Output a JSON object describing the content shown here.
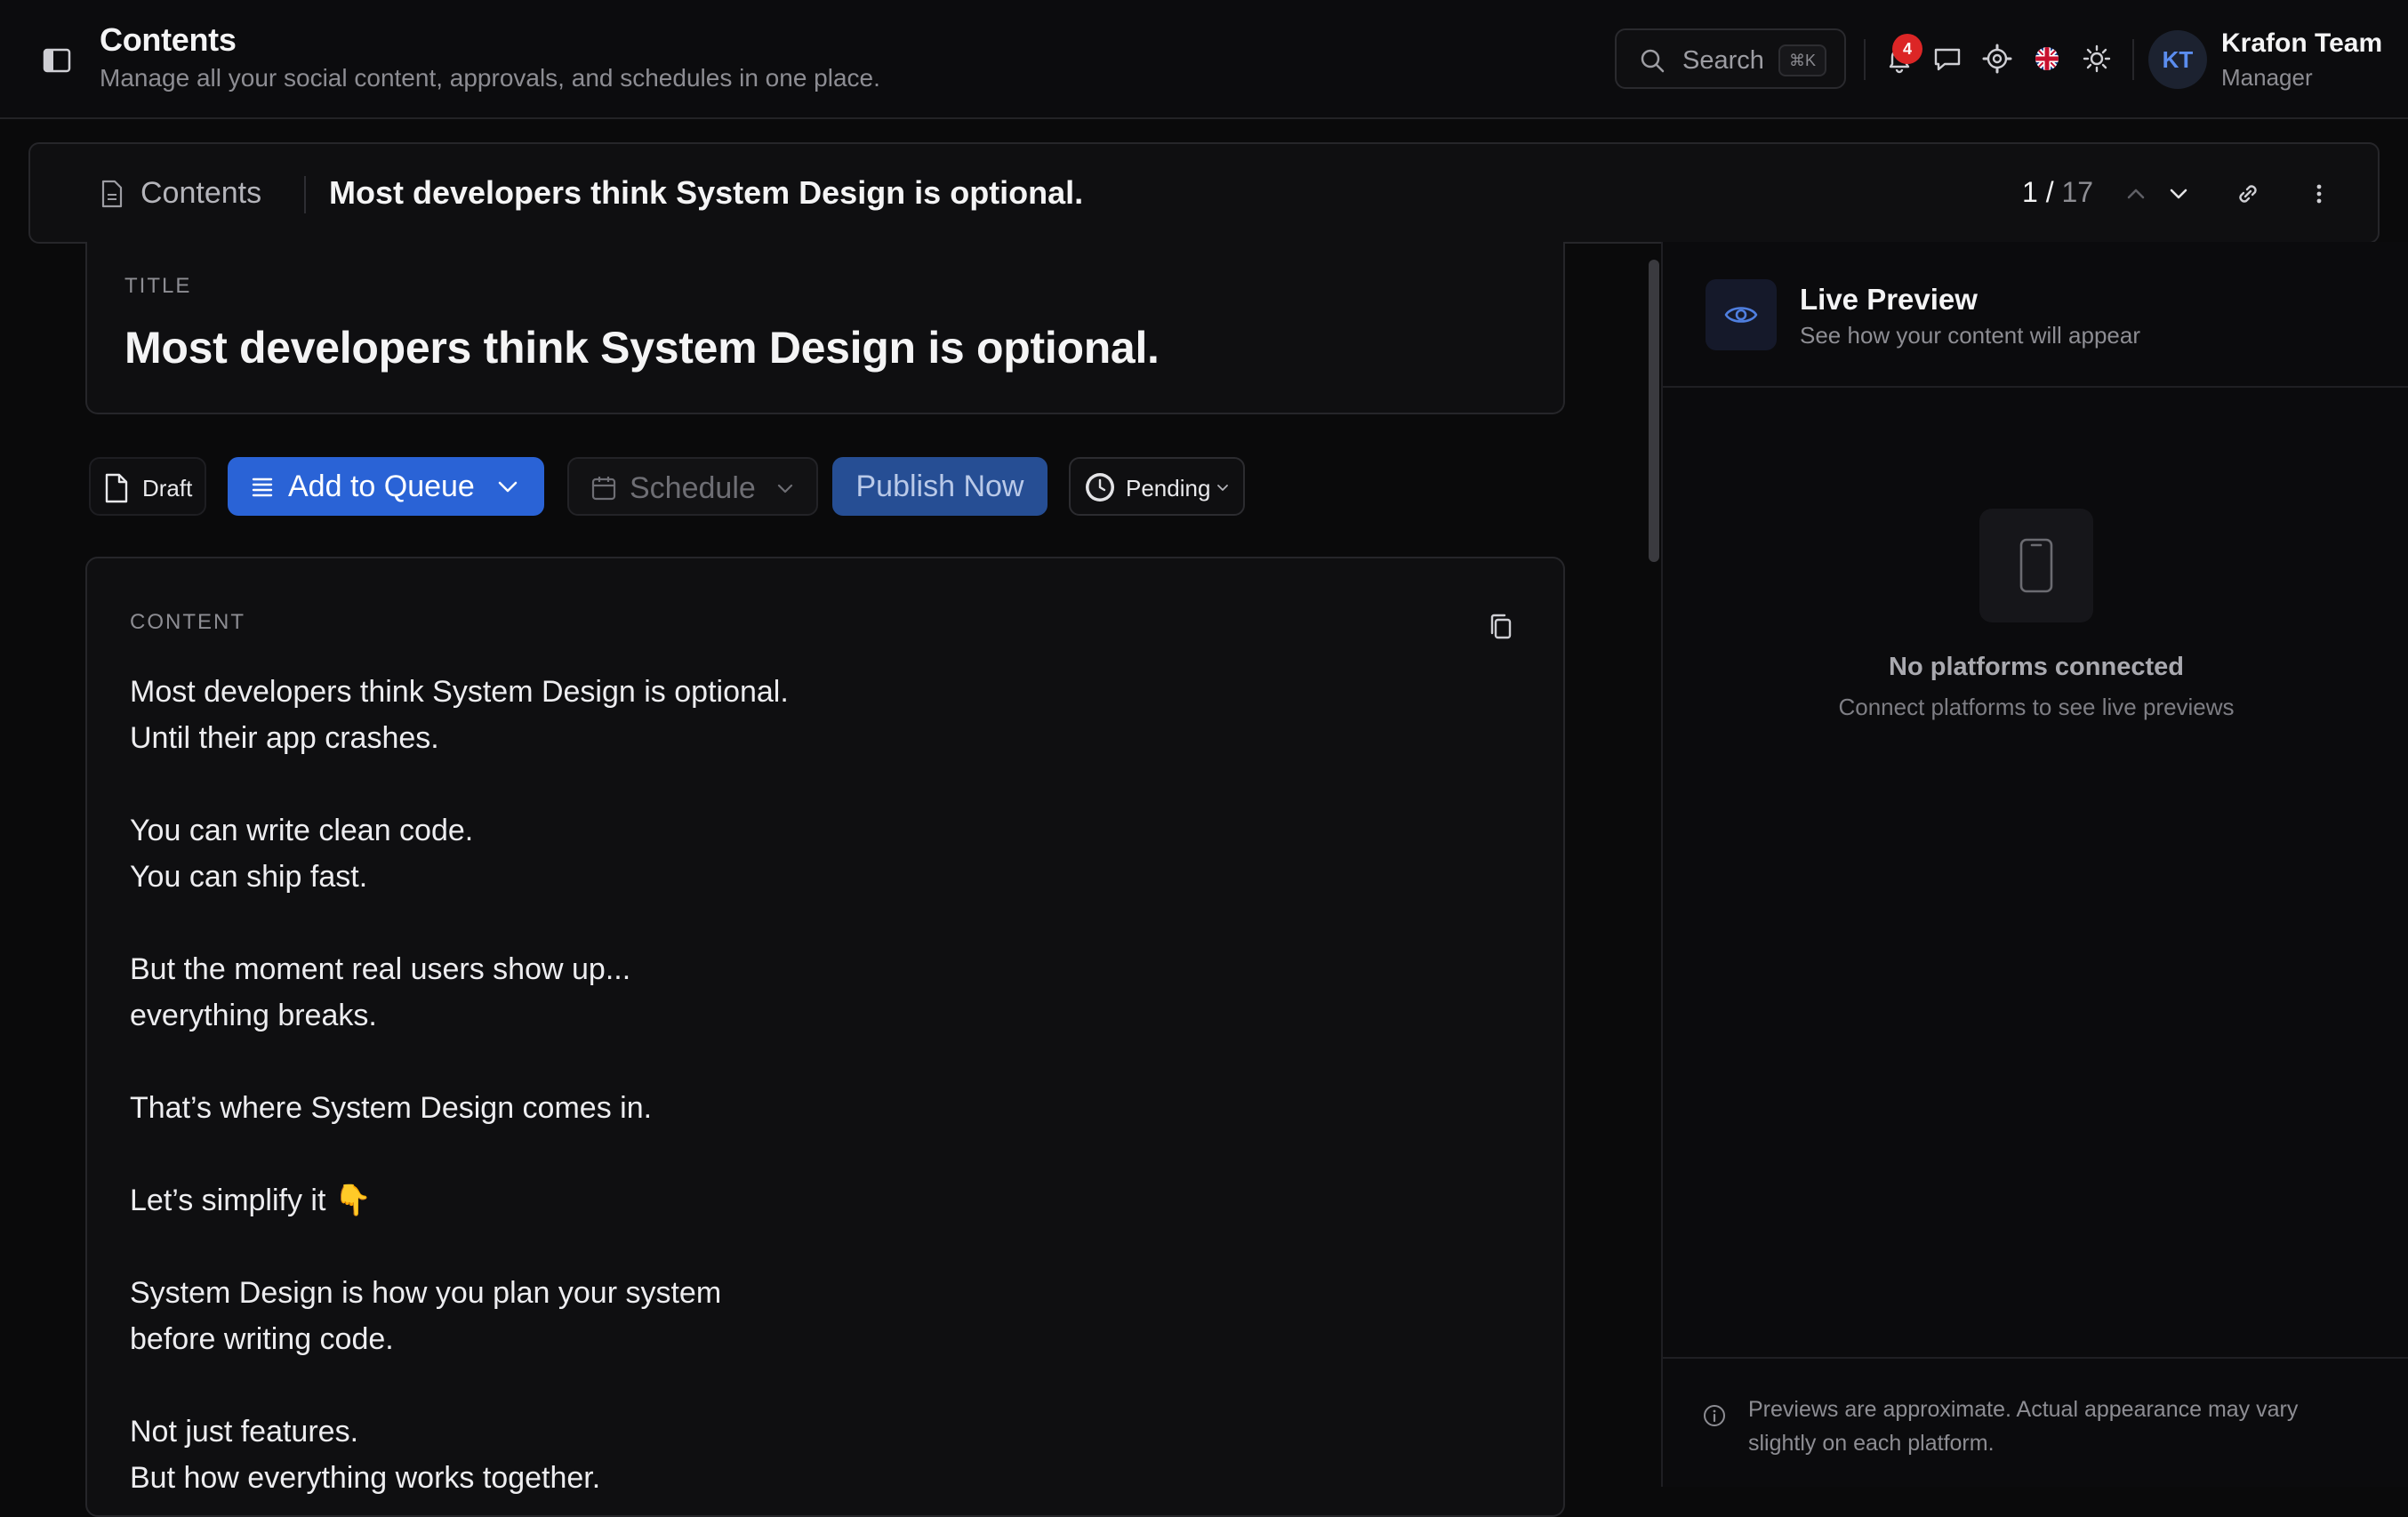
{
  "header": {
    "title": "Contents",
    "subtitle": "Manage all your social content, approvals, and schedules in one place.",
    "search_label": "Search",
    "search_shortcut": "⌘K",
    "notification_count": "4",
    "user_initials": "KT",
    "user_name": "Krafon Team",
    "user_role": "Manager",
    "icons": [
      "sidebar-toggle-icon",
      "search-icon",
      "bell-icon",
      "chat-icon",
      "gear-icon",
      "uk-flag-icon",
      "sun-icon"
    ]
  },
  "breadcrumb": {
    "section": "Contents",
    "current": "Most developers think System Design is optional.",
    "position": "1 /",
    "total": "17"
  },
  "editor": {
    "title_label": "TITLE",
    "title": "Most developers think System Design is optional.",
    "actions": {
      "draft": "Draft",
      "add_to_queue": "Add to Queue",
      "schedule": "Schedule",
      "publish_now": "Publish Now",
      "status": "Pending"
    },
    "content_label": "CONTENT",
    "content": "Most developers think System Design is optional.\nUntil their app crashes.\n\nYou can write clean code.\nYou can ship fast.\n\nBut the moment real users show up...\neverything breaks.\n\nThat’s where System Design comes in.\n\nLet’s simplify it 👇\n\nSystem Design is how you plan your system\nbefore writing code.\n\nNot just features.\nBut how everything works together."
  },
  "preview": {
    "title": "Live Preview",
    "subtitle": "See how your content will appear",
    "empty_title": "No platforms connected",
    "empty_subtitle": "Connect platforms to see live previews",
    "note": "Previews are approximate. Actual appearance may vary slightly on each platform."
  },
  "colors": {
    "accent": "#2a63d6",
    "publish": "#264e94",
    "badge": "#dc2626",
    "background": "#0a0a0b"
  }
}
